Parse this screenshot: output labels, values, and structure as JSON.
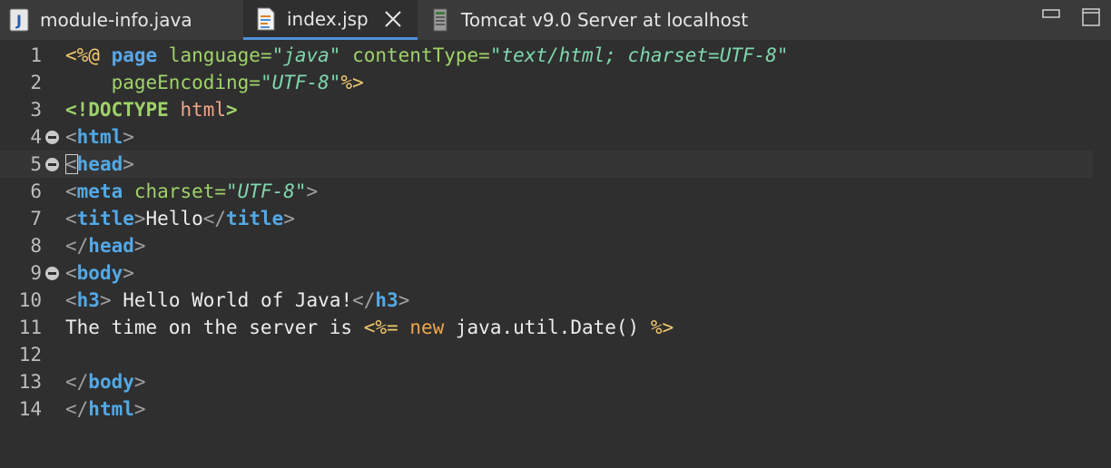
{
  "tabs": [
    {
      "label": "module-info.java",
      "icon": "java-file-icon",
      "active": false
    },
    {
      "label": "index.jsp",
      "icon": "jsp-file-icon",
      "active": true,
      "closable": true
    },
    {
      "label": "Tomcat v9.0 Server at localhost",
      "icon": "server-icon",
      "active": false
    }
  ],
  "window_controls": [
    "minimize-icon",
    "maximize-icon"
  ],
  "editor": {
    "line_numbers": [
      "1",
      "2",
      "3",
      "4",
      "5",
      "6",
      "7",
      "8",
      "9",
      "10",
      "11",
      "12",
      "13",
      "14"
    ],
    "current_line": 5,
    "folded_lines": [
      4,
      5,
      9
    ],
    "lines": [
      [
        {
          "t": "<%@ ",
          "c": "t-delim"
        },
        {
          "t": "page ",
          "c": "t-dirkw"
        },
        {
          "t": "language=",
          "c": "t-attr"
        },
        {
          "t": "\"java\"",
          "c": "t-str"
        },
        {
          "t": " contentType=",
          "c": "t-attr"
        },
        {
          "t": "\"text/html; charset=UTF-8\"",
          "c": "t-str"
        }
      ],
      [
        {
          "t": "    pageEncoding=",
          "c": "t-attr"
        },
        {
          "t": "\"UTF-8\"",
          "c": "t-str"
        },
        {
          "t": "%>",
          "c": "t-delim"
        }
      ],
      [
        {
          "t": "<!DOCTYPE ",
          "c": "t-doctype"
        },
        {
          "t": "html",
          "c": "t-doctype-name"
        },
        {
          "t": ">",
          "c": "t-doctype"
        }
      ],
      [
        {
          "t": "<",
          "c": "t-bracket"
        },
        {
          "t": "html",
          "c": "t-tag"
        },
        {
          "t": ">",
          "c": "t-bracket"
        }
      ],
      [
        {
          "t": "<",
          "c": "t-bracket"
        },
        {
          "t": "head",
          "c": "t-tag"
        },
        {
          "t": ">",
          "c": "t-bracket"
        }
      ],
      [
        {
          "t": "<",
          "c": "t-bracket"
        },
        {
          "t": "meta ",
          "c": "t-tag"
        },
        {
          "t": "charset=",
          "c": "t-attr"
        },
        {
          "t": "\"UTF-8\"",
          "c": "t-str"
        },
        {
          "t": ">",
          "c": "t-bracket"
        }
      ],
      [
        {
          "t": "<",
          "c": "t-bracket"
        },
        {
          "t": "title",
          "c": "t-tag"
        },
        {
          "t": ">",
          "c": "t-bracket"
        },
        {
          "t": "Hello",
          "c": "t-text"
        },
        {
          "t": "</",
          "c": "t-bracket"
        },
        {
          "t": "title",
          "c": "t-tag"
        },
        {
          "t": ">",
          "c": "t-bracket"
        }
      ],
      [
        {
          "t": "</",
          "c": "t-bracket"
        },
        {
          "t": "head",
          "c": "t-tag"
        },
        {
          "t": ">",
          "c": "t-bracket"
        }
      ],
      [
        {
          "t": "<",
          "c": "t-bracket"
        },
        {
          "t": "body",
          "c": "t-tag"
        },
        {
          "t": ">",
          "c": "t-bracket"
        }
      ],
      [
        {
          "t": "<",
          "c": "t-bracket"
        },
        {
          "t": "h3",
          "c": "t-tag"
        },
        {
          "t": ">",
          "c": "t-bracket"
        },
        {
          "t": " Hello World of Java!",
          "c": "t-text"
        },
        {
          "t": "</",
          "c": "t-bracket"
        },
        {
          "t": "h3",
          "c": "t-tag"
        },
        {
          "t": ">",
          "c": "t-bracket"
        }
      ],
      [
        {
          "t": "The time on the server is ",
          "c": "t-text"
        },
        {
          "t": "<%= ",
          "c": "t-delim"
        },
        {
          "t": "new ",
          "c": "t-kw"
        },
        {
          "t": "java.util.Date() ",
          "c": "t-text"
        },
        {
          "t": "%>",
          "c": "t-delim"
        }
      ],
      [],
      [
        {
          "t": "</",
          "c": "t-bracket"
        },
        {
          "t": "body",
          "c": "t-tag"
        },
        {
          "t": ">",
          "c": "t-bracket"
        }
      ],
      [
        {
          "t": "</",
          "c": "t-bracket"
        },
        {
          "t": "html",
          "c": "t-tag"
        },
        {
          "t": ">",
          "c": "t-bracket"
        }
      ]
    ]
  },
  "colors": {
    "background": "#2f2f2f",
    "tab_bar": "#3a3a3a",
    "active_tab_underline": "#4e90d8",
    "tag": "#52a9e6",
    "attribute": "#9fd26a",
    "string": "#7fd7ad",
    "jsp_delimiter": "#f2c96c",
    "keyword": "#f0a54a"
  }
}
